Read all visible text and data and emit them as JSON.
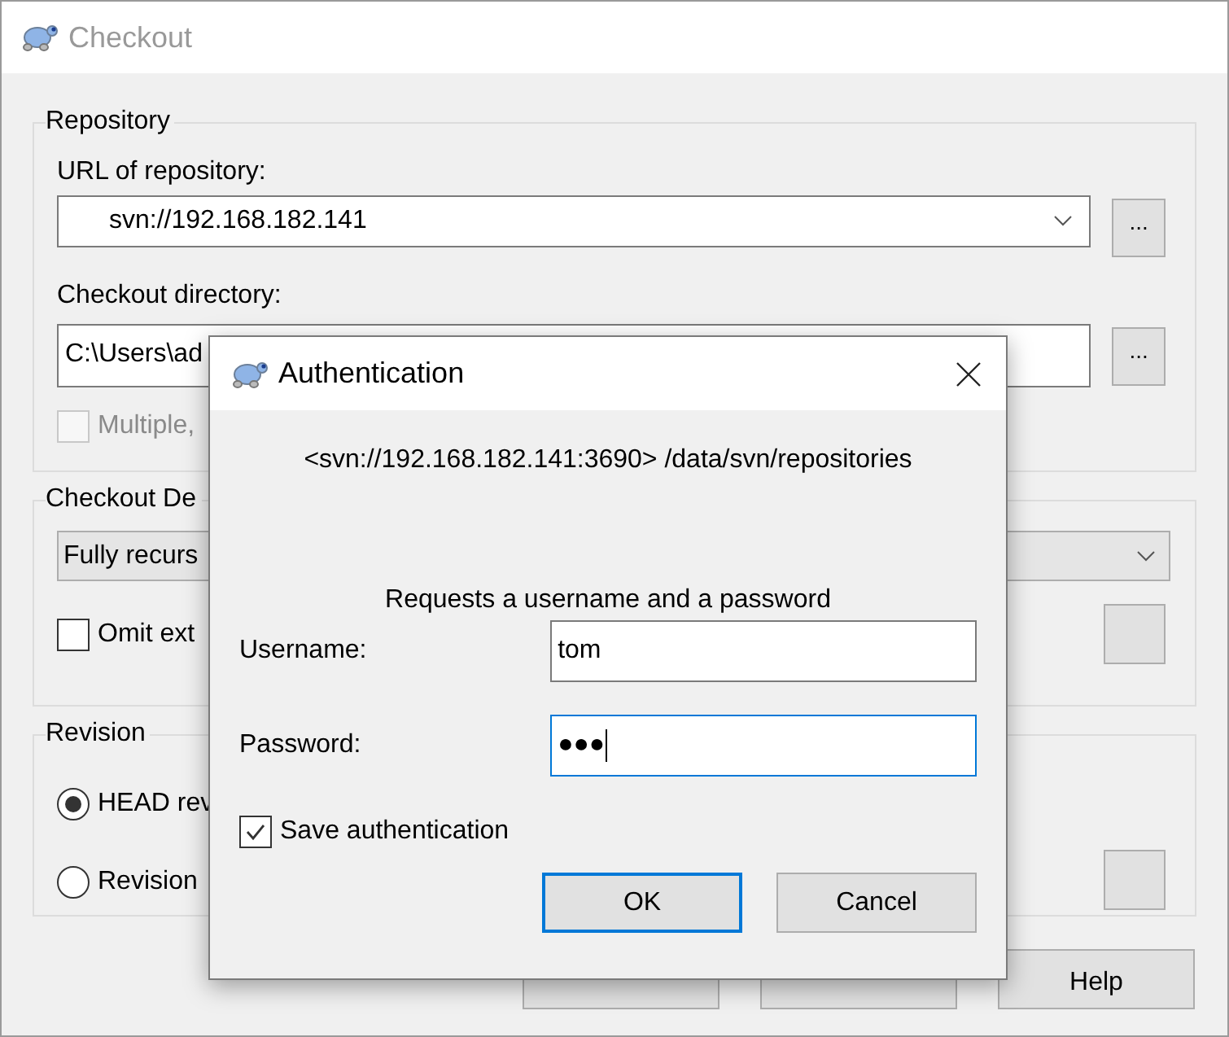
{
  "window": {
    "title": "Checkout"
  },
  "repository": {
    "title": "Repository",
    "url_label": "URL of repository:",
    "url_value": "svn://192.168.182.141",
    "browse_button": "...",
    "directory_label": "Checkout directory:",
    "directory_value": "C:\\Users\\ad",
    "directory_browse_button": "...",
    "multiple": {
      "label": "Multiple,",
      "checked": false,
      "disabled": true
    }
  },
  "depth": {
    "title": "Checkout De",
    "value": "Fully recurs",
    "omit_externals": {
      "label": "Omit ext",
      "checked": false
    }
  },
  "revision": {
    "title": "Revision",
    "options": [
      {
        "label": "HEAD rev",
        "selected": true
      },
      {
        "label": "Revision",
        "selected": false
      }
    ]
  },
  "buttons": [
    {
      "kind": "covered"
    },
    {
      "kind": "covered"
    },
    {
      "kind": "labeled",
      "label": "Help"
    }
  ],
  "auth_dialog": {
    "title": "Authentication",
    "realm": "<svn://192.168.182.141:3690> /data/svn/repositories",
    "prompt": "Requests a username and a password",
    "username_label": "Username:",
    "username_value": "tom",
    "password_label": "Password:",
    "password_value": "●●●",
    "password_focused": true,
    "save": {
      "label": "Save authentication",
      "checked": true
    },
    "buttons": [
      {
        "label": "OK",
        "default": true
      },
      {
        "label": "Cancel",
        "default": false
      }
    ]
  }
}
